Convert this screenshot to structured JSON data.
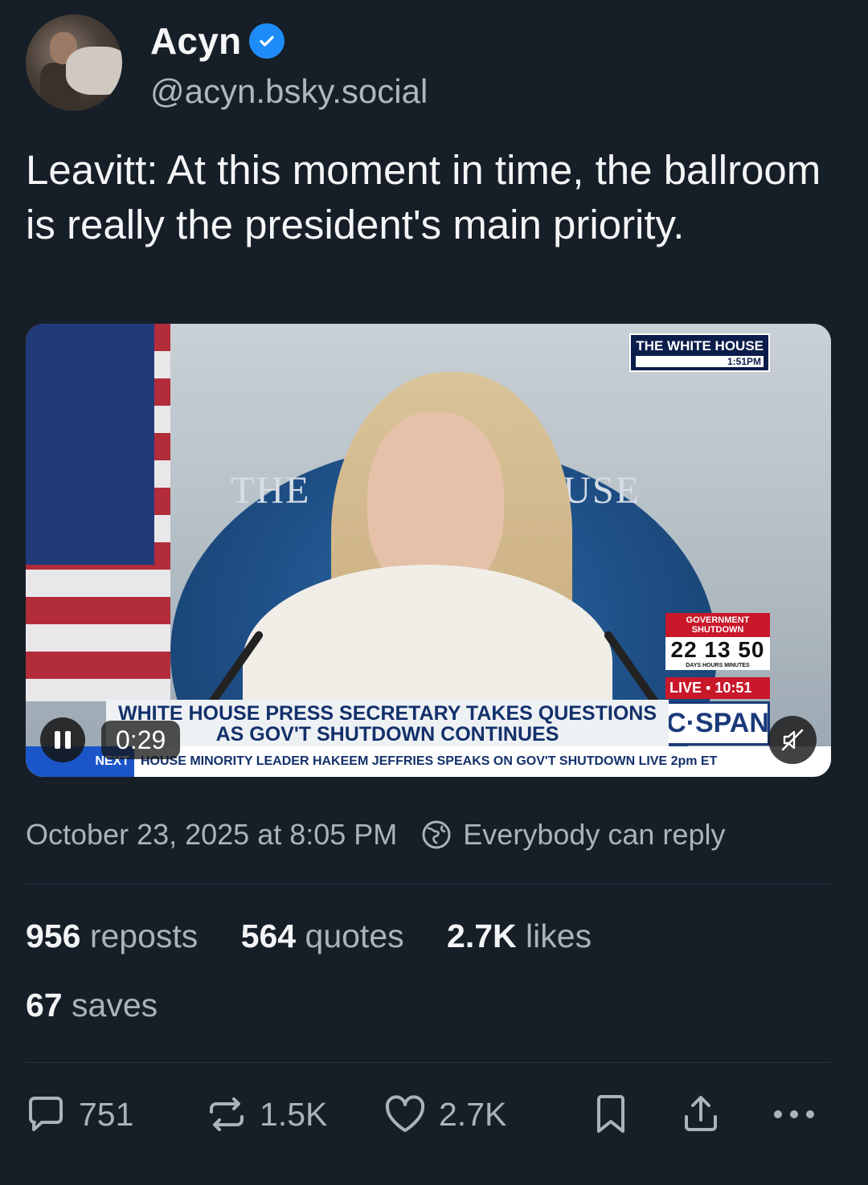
{
  "author": {
    "name": "Acyn",
    "handle": "@acyn.bsky.social",
    "verified": true
  },
  "post": {
    "text": "Leavitt: At this moment in time, the ballroom is really the president's main priority."
  },
  "video": {
    "elapsed": "0:29",
    "overlay": {
      "network_badge": "THE WHITE HOUSE",
      "network_time": "1:51PM",
      "backdrop_left": "THE",
      "backdrop_right": "HOUSE",
      "shutdown_label": "GOVERNMENT SHUTDOWN",
      "shutdown_counter": "22 13 50",
      "shutdown_units": "DAYS   HOURS   MINUTES",
      "live_label": "LIVE ▪ 10:51",
      "channel": "C·SPAN",
      "headline_line1": "WHITE HOUSE PRESS SECRETARY TAKES QUESTIONS",
      "headline_line2": "AS GOV'T SHUTDOWN CONTINUES",
      "ticker_label": "NEXT",
      "ticker_text": "HOUSE MINORITY LEADER HAKEEM JEFFRIES SPEAKS ON GOV'T SHUTDOWN  LIVE 2pm ET"
    }
  },
  "meta": {
    "timestamp": "October 23, 2025 at 8:05 PM",
    "reply_setting": "Everybody can reply"
  },
  "stats": {
    "reposts_count": "956",
    "reposts_label": "reposts",
    "quotes_count": "564",
    "quotes_label": "quotes",
    "likes_count": "2.7K",
    "likes_label": "likes",
    "saves_count": "67",
    "saves_label": "saves"
  },
  "actions": {
    "reply_count": "751",
    "repost_count": "1.5K",
    "like_count": "2.7K"
  },
  "colors": {
    "background": "#161e27",
    "verified": "#1d8cf8",
    "muted_text": "#aab2bc"
  }
}
